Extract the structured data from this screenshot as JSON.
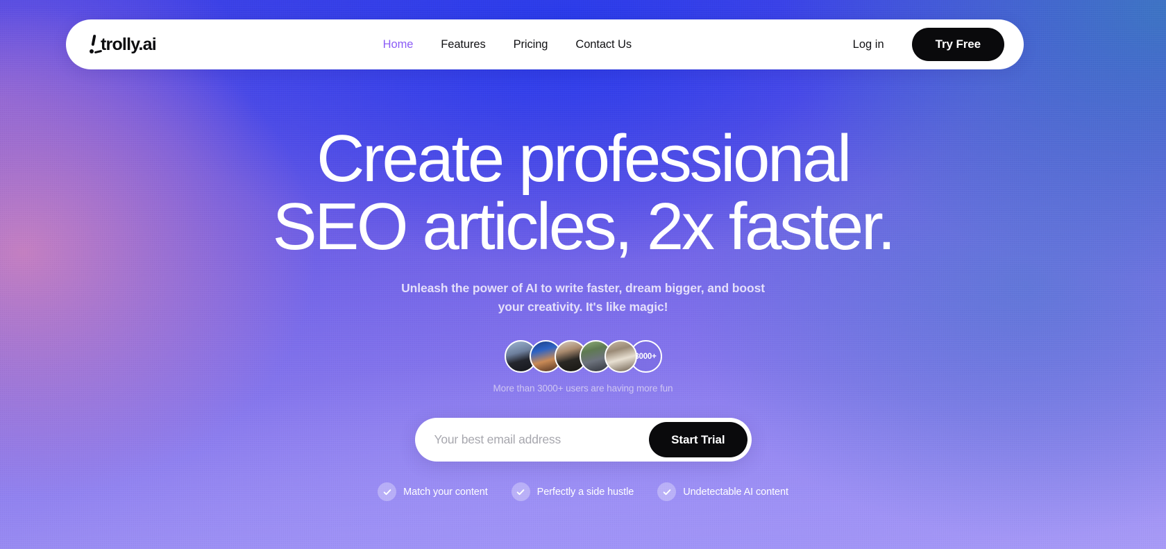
{
  "theme": {
    "accent_purple": "#8b5cf6",
    "button_black": "#0a0a0c",
    "headline_white": "#ffffff",
    "bg_top_center": "#283aeb",
    "bg_top_right": "#3d74c4",
    "bg_left_pink": "#c981c0",
    "bg_bottom_lavender": "#a094f8"
  },
  "navbar": {
    "logo_text": "trolly.ai",
    "logo_icon": "trolley-cart-icon",
    "links": [
      {
        "label": "Home",
        "active": true,
        "name": "nav-link-home"
      },
      {
        "label": "Features",
        "active": false,
        "name": "nav-link-features"
      },
      {
        "label": "Pricing",
        "active": false,
        "name": "nav-link-pricing"
      },
      {
        "label": "Contact Us",
        "active": false,
        "name": "nav-link-contact-us"
      }
    ],
    "login_label": "Log in",
    "try_free_label": "Try Free"
  },
  "hero": {
    "headline_line1": "Create professional",
    "headline_line2": "SEO articles, 2x faster.",
    "subhead_line1": "Unleash the power of AI to write faster, dream bigger, and boost",
    "subhead_line2": "your creativity. It's like magic!"
  },
  "social_proof": {
    "avatar_count": 5,
    "more_badge": "3000+",
    "caption": "More than 3000+ users are having more fun"
  },
  "signup_form": {
    "email_placeholder": "Your best email address",
    "email_value": "",
    "submit_label": "Start Trial"
  },
  "features": [
    {
      "label": "Match your content",
      "icon": "check-icon"
    },
    {
      "label": "Perfectly a side hustle",
      "icon": "check-icon"
    },
    {
      "label": "Undetectable AI content",
      "icon": "check-icon"
    }
  ]
}
